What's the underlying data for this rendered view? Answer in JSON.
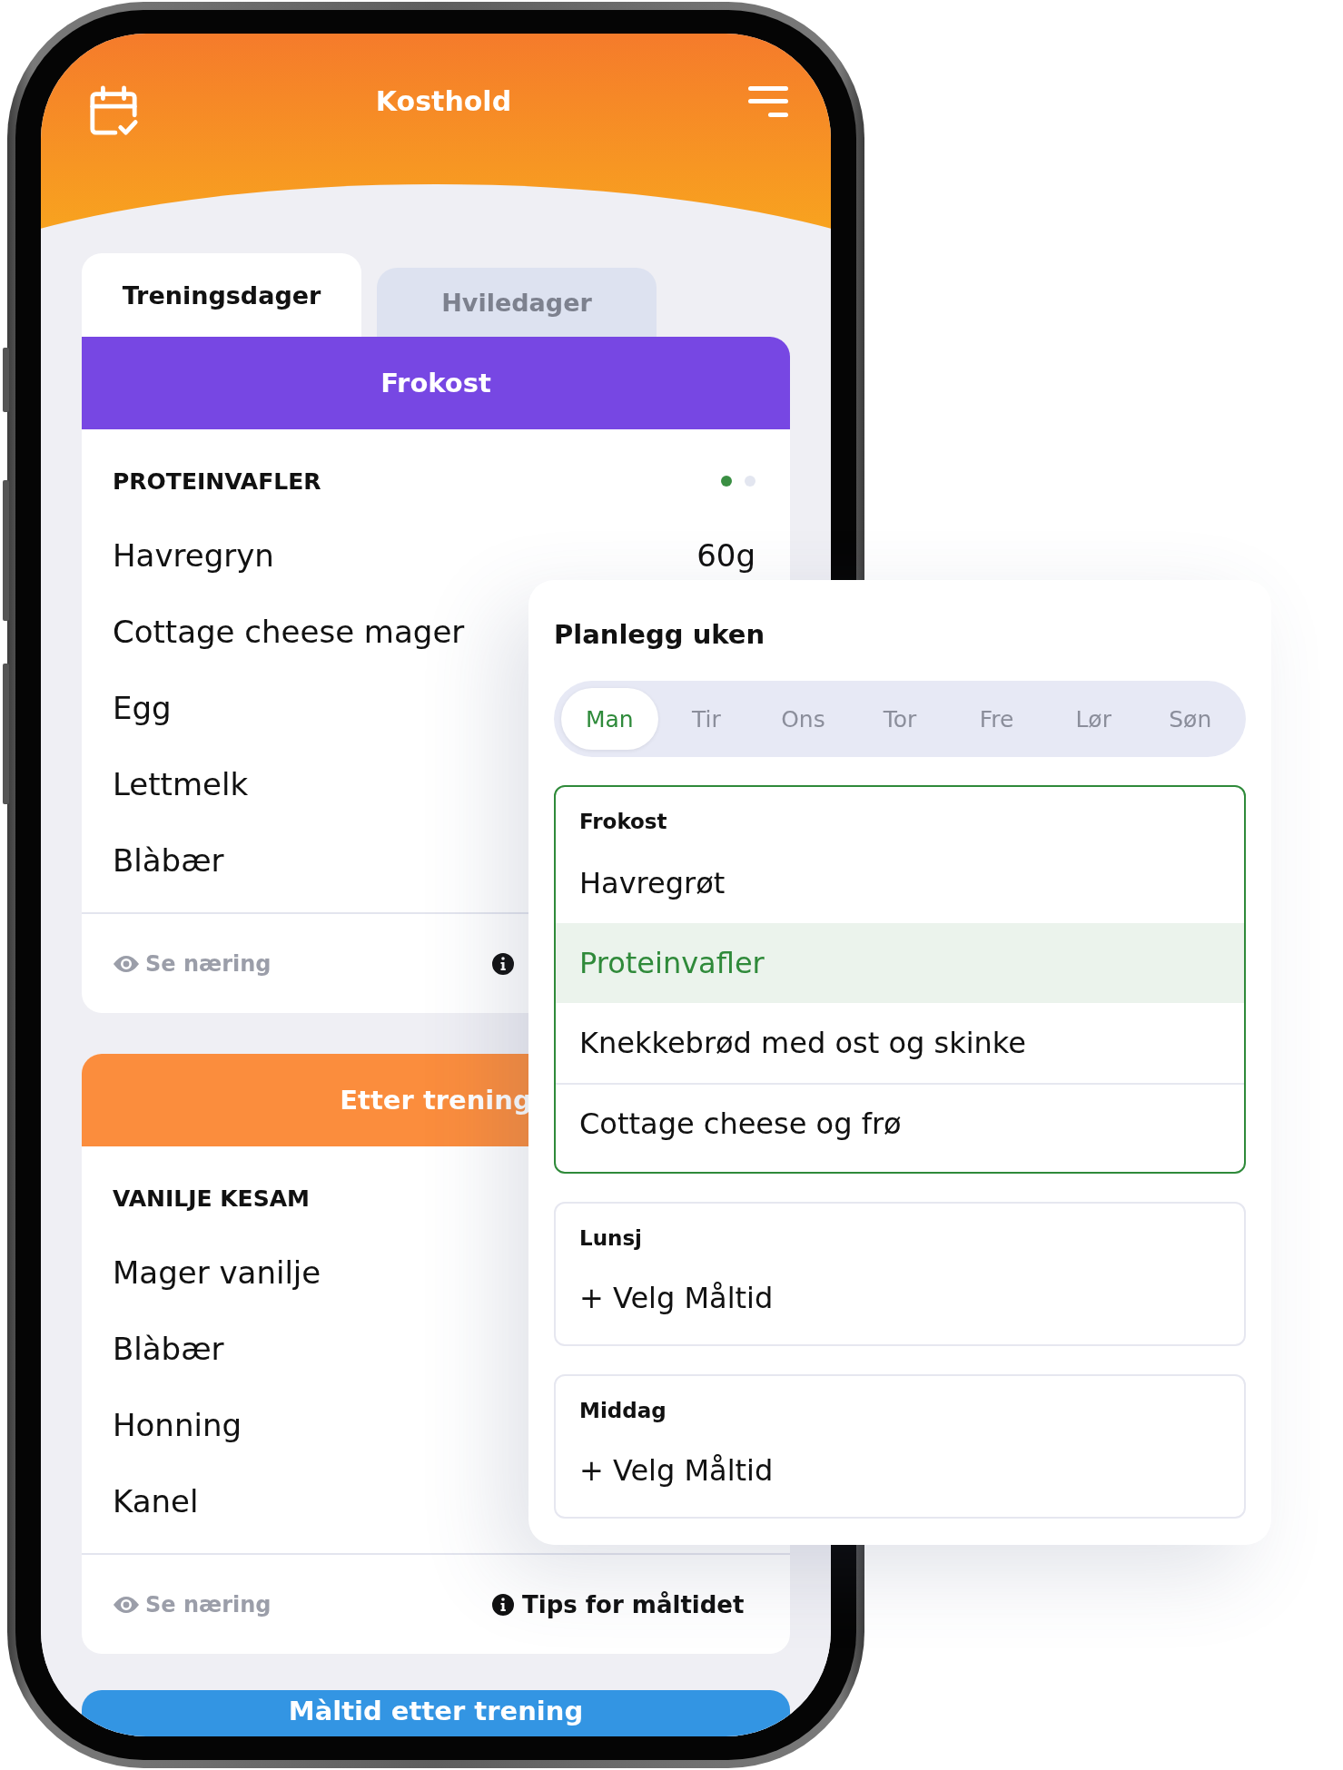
{
  "app_header": {
    "title": "Kosthold"
  },
  "tabs": [
    {
      "label": "Treningsdager",
      "selected": true
    },
    {
      "label": "Hviledager",
      "selected": false
    }
  ],
  "meal_cards": [
    {
      "title": "Frokost",
      "color": "#7747e3",
      "recipe": "PROTEINVAFLER",
      "dots": [
        {
          "selected": true
        },
        {
          "selected": false
        }
      ],
      "ingredients": [
        {
          "name": "Havregryn",
          "amount": "60g"
        },
        {
          "name": "Cottage cheese mager"
        },
        {
          "name": "Egg"
        },
        {
          "name": "Lettmelk"
        },
        {
          "name": "Blàbær"
        }
      ],
      "footer": {
        "nutrition": "Se næring"
      }
    },
    {
      "title": "Etter trening",
      "color": "#fb8d3d",
      "recipe": "VANILJE KESAM",
      "ingredients": [
        {
          "name": "Mager vanilje"
        },
        {
          "name": "Blàbær"
        },
        {
          "name": "Honning"
        },
        {
          "name": "Kanel"
        }
      ],
      "footer": {
        "nutrition": "Se næring",
        "tips": "Tips for måltidet"
      }
    },
    {
      "title": "Màltid etter trening",
      "color": "#3395e3"
    }
  ],
  "week_planner": {
    "title": "Planlegg uken",
    "days": [
      {
        "label": "Man",
        "selected": true
      },
      {
        "label": "Tir",
        "selected": false
      },
      {
        "label": "Ons",
        "selected": false
      },
      {
        "label": "Tor",
        "selected": false
      },
      {
        "label": "Fre",
        "selected": false
      },
      {
        "label": "Lør",
        "selected": false
      },
      {
        "label": "Søn",
        "selected": false
      }
    ],
    "slots": [
      {
        "kind": "choices",
        "title": "Frokost",
        "active": true,
        "options": [
          {
            "label": "Havregrøt",
            "selected": false
          },
          {
            "label": "Proteinvafler",
            "selected": true
          },
          {
            "label": "Knekkebrød med ost og skinke",
            "selected": false
          },
          {
            "label": "Cottage cheese og frø",
            "selected": false
          }
        ]
      },
      {
        "kind": "empty",
        "title": "Lunsj",
        "active": false,
        "action": "+ Velg Måltid"
      },
      {
        "kind": "empty",
        "title": "Middag",
        "active": false,
        "action": "+ Velg Måltid"
      }
    ]
  }
}
